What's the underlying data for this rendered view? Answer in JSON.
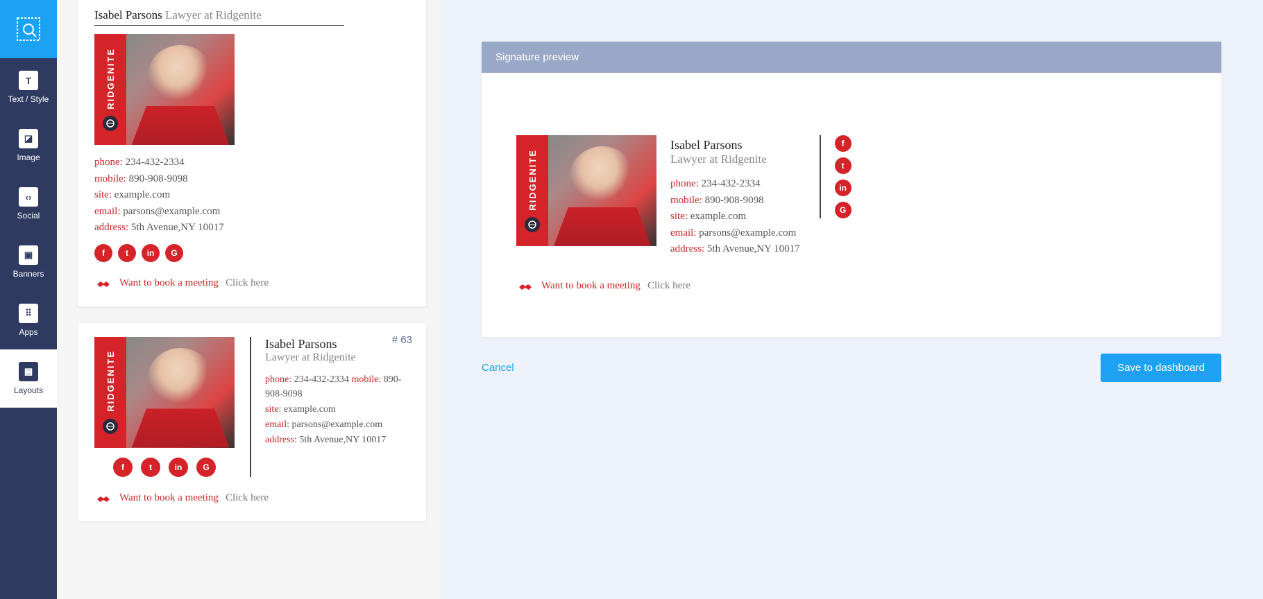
{
  "sidebar": {
    "items": [
      {
        "label": "Text / Style",
        "icon": "T"
      },
      {
        "label": "Image",
        "icon": "◪"
      },
      {
        "label": "Social",
        "icon": "‹›"
      },
      {
        "label": "Banners",
        "icon": "▣"
      },
      {
        "label": "Apps",
        "icon": "⠿"
      },
      {
        "label": "Layouts",
        "icon": "▦"
      }
    ]
  },
  "person": {
    "name": "Isabel Parsons",
    "title": "Lawyer at Ridgenite",
    "company_vert": "RIDGENITE"
  },
  "labels": {
    "phone": "phone:",
    "mobile": "mobile:",
    "site": "site:",
    "email": "email:",
    "address": "address:"
  },
  "contact": {
    "phone": "234-432-2334",
    "mobile": "890-908-9098",
    "site": "example.com",
    "email": "parsons@example.com",
    "address": "5th Avenue,NY 10017"
  },
  "socials": [
    "f",
    "t",
    "in",
    "G"
  ],
  "meeting": {
    "text": "Want to book a meeting",
    "click": "Click here"
  },
  "card2": {
    "num": "# 63"
  },
  "preview": {
    "header": "Signature preview"
  },
  "actions": {
    "cancel": "Cancel",
    "save": "Save to dashboard"
  }
}
